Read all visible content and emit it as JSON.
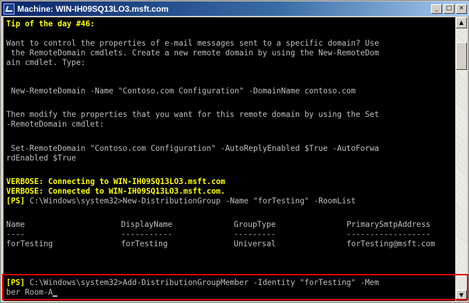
{
  "window": {
    "title": "Machine: WIN-IH09SQ13LO3.msft.com",
    "buttons": {
      "minimize": "_",
      "maximize": "□",
      "close": "×"
    }
  },
  "console": {
    "tip_title": "Tip of the day #46:",
    "tip_line1": "Want to control the properties of e-mail messages sent to a specific domain? Use",
    "tip_line2": " the RemoteDomain cmdlets. Create a new remote domain by using the New-RemoteDom",
    "tip_line3": "ain cmdlet. Type:",
    "cmd_new": " New-RemoteDomain -Name \"Contoso.com Configuration\" -DomainName contoso.com",
    "tip_line4": "Then modify the properties that you want for this remote domain by using the Set",
    "tip_line5": "-RemoteDomain cmdlet:",
    "cmd_set1": " Set-RemoteDomain \"Contoso.com Configuration\" -AutoReplyEnabled $True -AutoForwa",
    "cmd_set2": "rdEnabled $True",
    "verbose1": "VERBOSE: Connecting to WIN-IH09SQ13LO3.msft.com",
    "verbose2": "VERBOSE: Connected to WIN-IH09SQ13LO3.msft.com.",
    "ps_prompt": "[PS]",
    "cmd_newdg": " C:\\Windows\\system32>New-DistributionGroup -Name \"forTesting\" -RoomList",
    "table": {
      "headers": [
        "Name",
        "DisplayName",
        "GroupType",
        "PrimarySmtpAddress"
      ],
      "separators": [
        "----",
        "-----------",
        "---------",
        "------------------"
      ],
      "row": [
        "forTesting",
        "forTesting",
        "Universal",
        "forTesting@msft.com"
      ]
    },
    "cmd_add1": " C:\\Windows\\system32>Add-DistributionGroupMember -Identity \"forTesting\" -Mem",
    "cmd_add2": "ber Room-A"
  },
  "scrollbar": {
    "up": "▲",
    "down": "▼"
  }
}
